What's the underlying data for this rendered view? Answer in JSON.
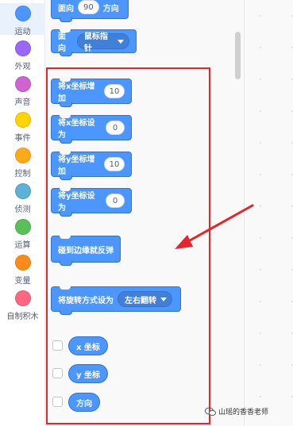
{
  "categories": [
    {
      "label": "运动",
      "color": "#4c97ff",
      "selected": true
    },
    {
      "label": "外观",
      "color": "#9966ff"
    },
    {
      "label": "声音",
      "color": "#cf63cf"
    },
    {
      "label": "事件",
      "color": "#ffd500"
    },
    {
      "label": "控制",
      "color": "#ffab19"
    },
    {
      "label": "侦测",
      "color": "#5cb1d6"
    },
    {
      "label": "运算",
      "color": "#59c059"
    },
    {
      "label": "变量",
      "color": "#ff8c1a"
    },
    {
      "label": "自制积木",
      "color": "#ff6680"
    }
  ],
  "blocks": {
    "point_in_direction": {
      "pre": "面向",
      "value": "90",
      "post": "方向"
    },
    "point_towards": {
      "pre": "面向",
      "dropdown": "鼠标指针"
    },
    "change_x": {
      "label": "将x坐标增加",
      "value": "10"
    },
    "set_x": {
      "label": "将x坐标设为",
      "value": "0"
    },
    "change_y": {
      "label": "将y坐标增加",
      "value": "10"
    },
    "set_y": {
      "label": "将y坐标设为",
      "value": "0"
    },
    "bounce": {
      "label": "碰到边缘就反弹"
    },
    "rotation_style": {
      "label": "将旋转方式设为",
      "dropdown": "左右翻转"
    }
  },
  "reporters": [
    {
      "label": "x 坐标"
    },
    {
      "label": "y 坐标"
    },
    {
      "label": "方向"
    }
  ],
  "watermark": {
    "text": "山瑶的香香老师"
  },
  "colors": {
    "motion": "#4c97ff",
    "motion_border": "#3373cc",
    "highlight": "#e6252a"
  }
}
